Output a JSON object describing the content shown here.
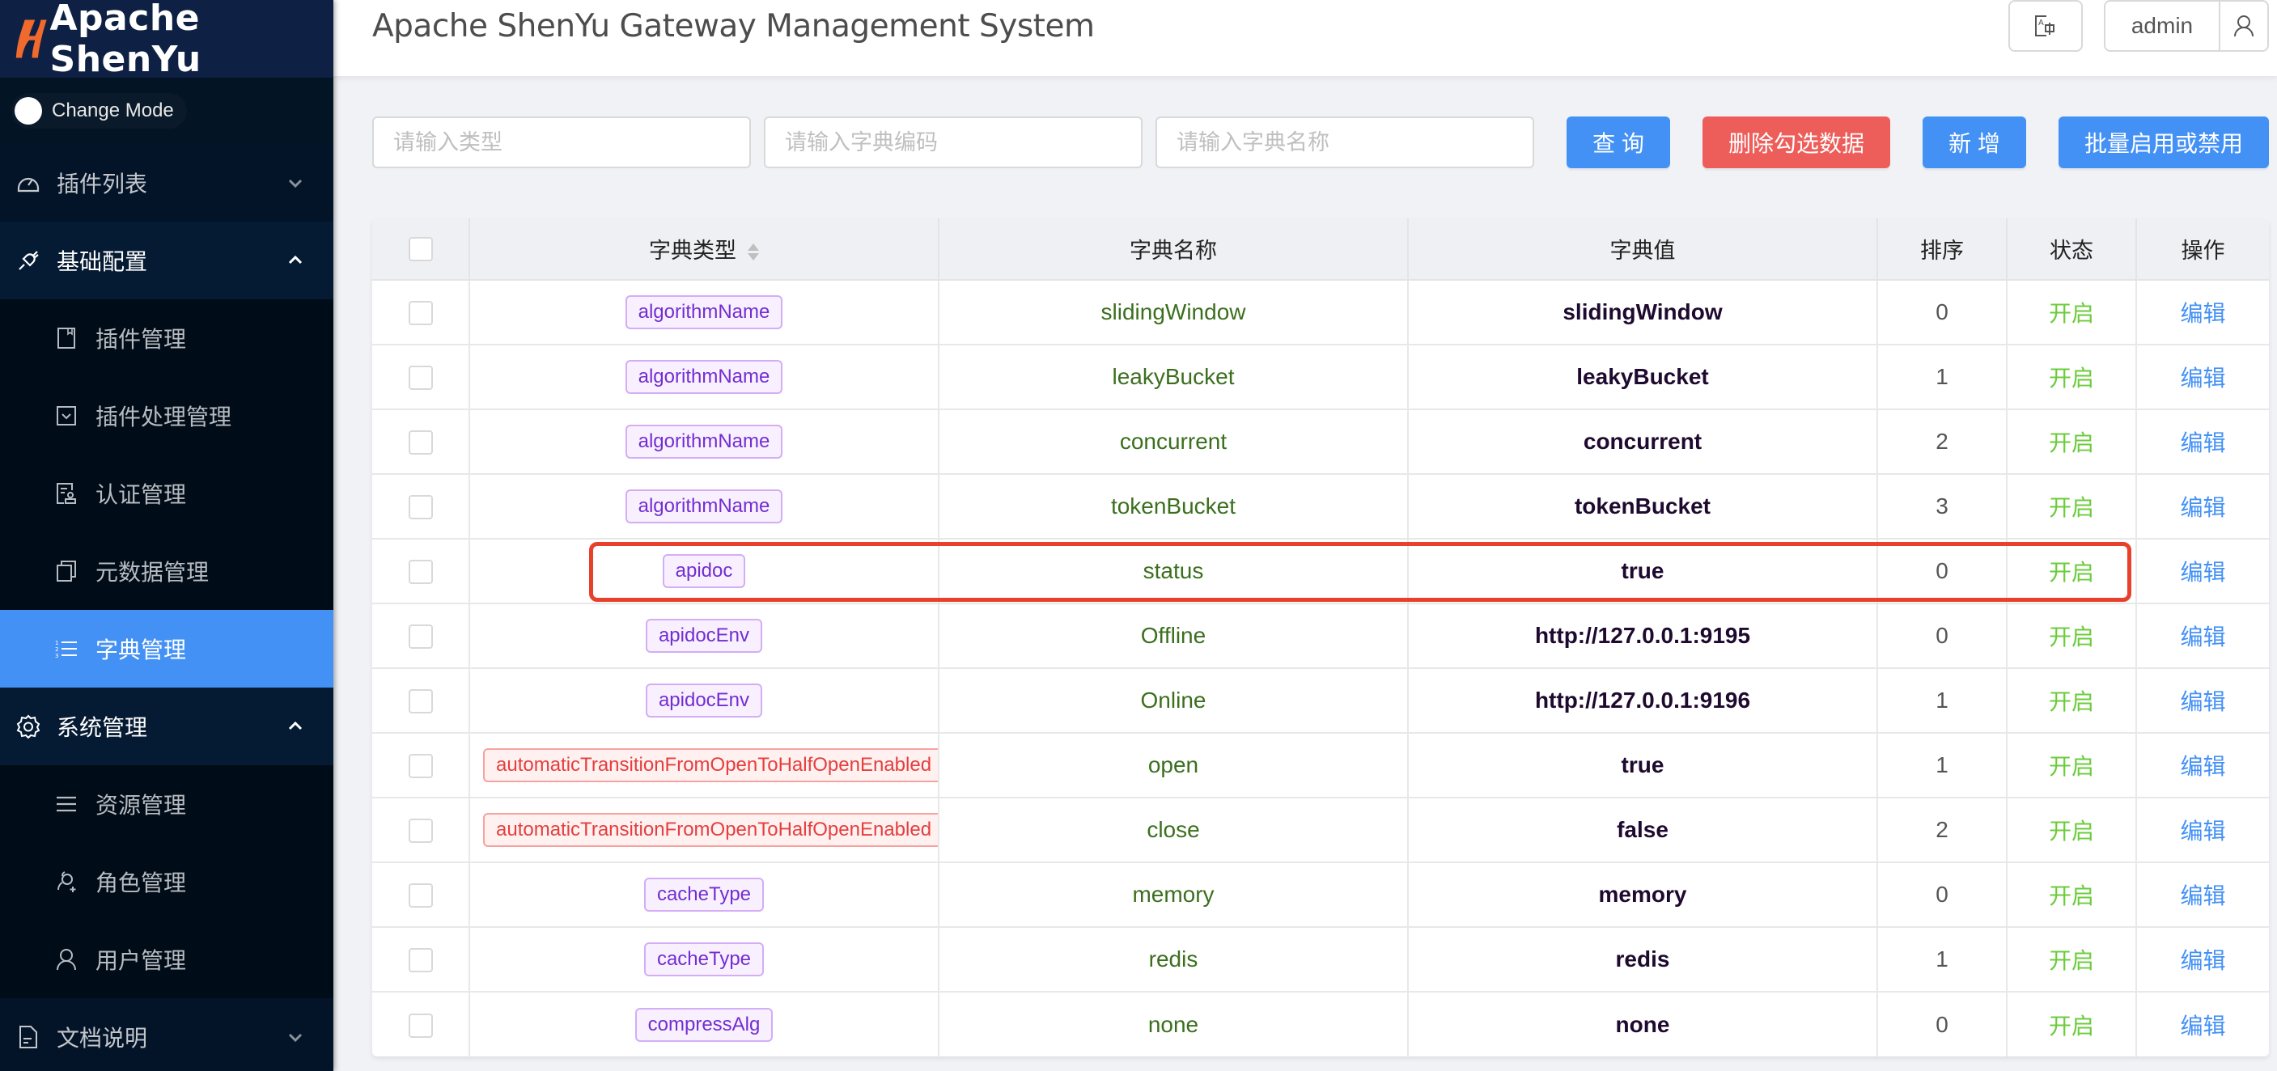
{
  "app": {
    "logo_text": "Apache ShenYu",
    "change_mode_label": "Change Mode",
    "title": "Apache ShenYu Gateway Management System",
    "user_name": "admin"
  },
  "sidebar": {
    "groups": [
      {
        "label": "插件列表",
        "icon": "dashboard-icon",
        "expanded": false
      },
      {
        "label": "基础配置",
        "icon": "plug-icon",
        "expanded": true,
        "items": [
          {
            "label": "插件管理",
            "icon": "book-icon"
          },
          {
            "label": "插件处理管理",
            "icon": "check-square-icon"
          },
          {
            "label": "认证管理",
            "icon": "audit-icon"
          },
          {
            "label": "元数据管理",
            "icon": "copy-icon"
          },
          {
            "label": "字典管理",
            "icon": "ordered-list-icon",
            "active": true
          }
        ]
      },
      {
        "label": "系统管理",
        "icon": "gear-icon",
        "expanded": true,
        "items": [
          {
            "label": "资源管理",
            "icon": "menu-icon"
          },
          {
            "label": "角色管理",
            "icon": "user-add-icon"
          },
          {
            "label": "用户管理",
            "icon": "user-icon"
          }
        ]
      },
      {
        "label": "文档说明",
        "icon": "file-icon",
        "expanded": false
      }
    ]
  },
  "search": {
    "type_placeholder": "请输入类型",
    "code_placeholder": "请输入字典编码",
    "name_placeholder": "请输入字典名称",
    "query_label": "查 询",
    "delete_label": "删除勾选数据",
    "add_label": "新 增",
    "batch_label": "批量启用或禁用"
  },
  "table": {
    "columns": [
      "字典类型",
      "字典名称",
      "字典值",
      "排序",
      "状态",
      "操作"
    ],
    "rows": [
      {
        "type": "algorithmName",
        "tag_color": "purple",
        "name": "slidingWindow",
        "value": "slidingWindow",
        "sort": "0",
        "status": "开启",
        "action": "编辑"
      },
      {
        "type": "algorithmName",
        "tag_color": "purple",
        "name": "leakyBucket",
        "value": "leakyBucket",
        "sort": "1",
        "status": "开启",
        "action": "编辑"
      },
      {
        "type": "algorithmName",
        "tag_color": "purple",
        "name": "concurrent",
        "value": "concurrent",
        "sort": "2",
        "status": "开启",
        "action": "编辑"
      },
      {
        "type": "algorithmName",
        "tag_color": "purple",
        "name": "tokenBucket",
        "value": "tokenBucket",
        "sort": "3",
        "status": "开启",
        "action": "编辑"
      },
      {
        "type": "apidoc",
        "tag_color": "purple",
        "name": "status",
        "value": "true",
        "sort": "0",
        "status": "开启",
        "action": "编辑",
        "highlighted": true
      },
      {
        "type": "apidocEnv",
        "tag_color": "purple",
        "name": "Offline",
        "value": "http://127.0.0.1:9195",
        "sort": "0",
        "status": "开启",
        "action": "编辑"
      },
      {
        "type": "apidocEnv",
        "tag_color": "purple",
        "name": "Online",
        "value": "http://127.0.0.1:9196",
        "sort": "1",
        "status": "开启",
        "action": "编辑"
      },
      {
        "type": "automaticTransitionFromOpenToHalfOpenEnabled",
        "tag_color": "red",
        "name": "open",
        "value": "true",
        "sort": "1",
        "status": "开启",
        "action": "编辑"
      },
      {
        "type": "automaticTransitionFromOpenToHalfOpenEnabled",
        "tag_color": "red",
        "name": "close",
        "value": "false",
        "sort": "2",
        "status": "开启",
        "action": "编辑"
      },
      {
        "type": "cacheType",
        "tag_color": "purple",
        "name": "memory",
        "value": "memory",
        "sort": "0",
        "status": "开启",
        "action": "编辑"
      },
      {
        "type": "cacheType",
        "tag_color": "purple",
        "name": "redis",
        "value": "redis",
        "sort": "1",
        "status": "开启",
        "action": "编辑"
      },
      {
        "type": "compressAlg",
        "tag_color": "purple",
        "name": "none",
        "value": "none",
        "sort": "0",
        "status": "开启",
        "action": "编辑"
      }
    ]
  },
  "colors": {
    "sidebar_bg": "#001529",
    "active_menu": "#4491f5",
    "primary": "#4491f5",
    "danger": "#ed5e5a",
    "status_on": "#52c41a",
    "highlight_outline": "#e8412b"
  }
}
